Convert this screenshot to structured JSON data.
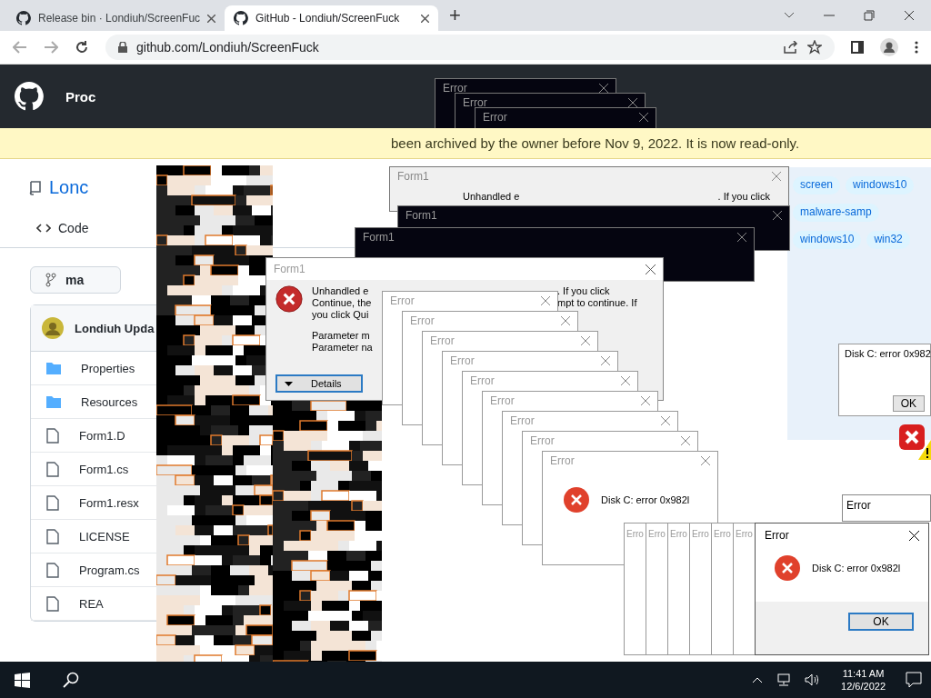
{
  "browser": {
    "tabs": [
      {
        "title": "Release bin · Londiuh/ScreenFuc",
        "selected": false
      },
      {
        "title": "GitHub - Londiuh/ScreenFuck",
        "selected": true
      }
    ],
    "new_tab": "+",
    "url": "github.com/Londiuh/ScreenFuck"
  },
  "github": {
    "header_text": "Proc",
    "repo_name": "Lonc",
    "tab": "Code",
    "branch": "ma",
    "commit_author": "Londiuh Upda",
    "files": [
      {
        "name": "Properties",
        "kind": "folder"
      },
      {
        "name": "Resources",
        "kind": "folder"
      },
      {
        "name": "Form1.D",
        "kind": "file"
      },
      {
        "name": "Form1.cs",
        "kind": "file"
      },
      {
        "name": "Form1.resx",
        "kind": "file"
      },
      {
        "name": "LICENSE",
        "kind": "file"
      },
      {
        "name": "Program.cs",
        "kind": "file"
      },
      {
        "name": "REA",
        "kind": "file"
      }
    ]
  },
  "archive_notice": "been archived by the owner before Nov 9, 2022. It is now read-only.",
  "back_windows": [
    {
      "title": "Error",
      "kind": "dark"
    },
    {
      "title": "Error",
      "kind": "dark"
    },
    {
      "title": "Error",
      "kind": "dark"
    },
    {
      "title": "Form1",
      "kind": "light",
      "text_left": "Unhandled e",
      "text_right": ". If you click"
    },
    {
      "title": "Form1",
      "kind": "dark"
    },
    {
      "title": "Form1",
      "kind": "dark"
    }
  ],
  "form1_dialog": {
    "title": "Form1",
    "message_left": [
      "Unhandled e",
      "Continue, the",
      "you click Qui"
    ],
    "message_right": [
      ". If you click",
      "mpt to continue. If"
    ],
    "parameters": [
      "Parameter m",
      "Parameter na"
    ],
    "details_button": "Details"
  },
  "error_cascade": [
    {
      "title": "Error"
    },
    {
      "title": "Error"
    },
    {
      "title": "Error"
    },
    {
      "title": "Error"
    },
    {
      "title": "Error"
    },
    {
      "title": "Error"
    },
    {
      "title": "Error"
    },
    {
      "title": "Error"
    },
    {
      "title": "Error",
      "message": "Disk C: error 0x982l"
    }
  ],
  "error_strip": [
    "Erro",
    "Erro",
    "Erro",
    "Erro",
    "Erro",
    "Erro"
  ],
  "final_dialog": {
    "title": "Error",
    "message": "Disk C: error 0x982l",
    "button": "OK"
  },
  "side_panel": {
    "tags": [
      "screen",
      "windows10",
      "malware-samp",
      "windows10",
      "win32"
    ],
    "error_text": "Disk C: error 0x982",
    "button": "OK",
    "window_title": "Error"
  },
  "taskbar": {
    "time": "11:41 AM",
    "date": "12/6/2022"
  }
}
